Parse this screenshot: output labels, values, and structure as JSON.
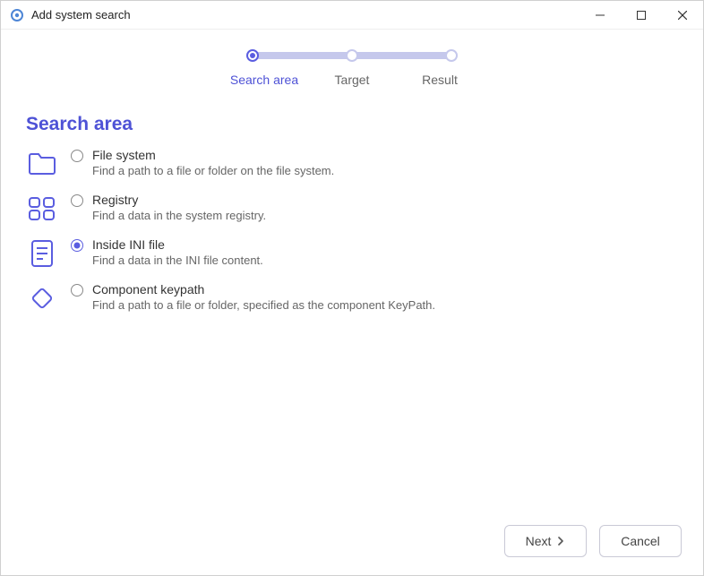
{
  "window": {
    "title": "Add system search"
  },
  "stepper": {
    "steps": [
      {
        "label": "Search area",
        "active": true
      },
      {
        "label": "Target",
        "active": false
      },
      {
        "label": "Result",
        "active": false
      }
    ]
  },
  "section": {
    "heading": "Search area"
  },
  "options": [
    {
      "id": "file-system",
      "title": "File system",
      "desc": "Find a path to a file or folder on the file system.",
      "selected": false
    },
    {
      "id": "registry",
      "title": "Registry",
      "desc": "Find a data in the system registry.",
      "selected": false
    },
    {
      "id": "ini",
      "title": "Inside INI file",
      "desc": "Find a data in the INI file content.",
      "selected": true
    },
    {
      "id": "component-keypath",
      "title": "Component keypath",
      "desc": "Find a path to a file or folder, specified as the component KeyPath.",
      "selected": false
    }
  ],
  "footer": {
    "next": "Next",
    "cancel": "Cancel"
  }
}
